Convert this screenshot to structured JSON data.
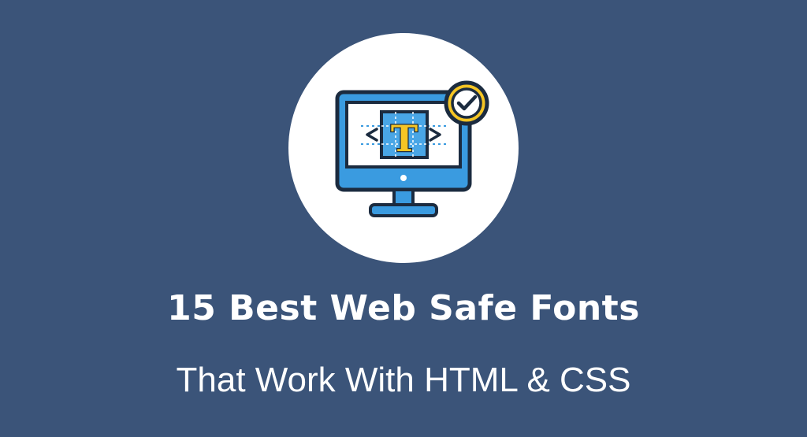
{
  "hero": {
    "title": "15 Best Web Safe Fonts",
    "subtitle": "That Work With HTML & CSS",
    "illustration": {
      "icon": "monitor-with-type-icon",
      "letter": "T",
      "badge_icon": "checkmark-icon"
    }
  },
  "colors": {
    "background": "#3b5479",
    "circle": "#ffffff",
    "outline": "#1b2b3f",
    "screen_blue": "#3a9be0",
    "screen_inner": "#ffffff",
    "type_box": "#49a6e6",
    "letter_yellow": "#f5c524",
    "badge_yellow": "#f5c524",
    "title_text": "#ffffff"
  }
}
